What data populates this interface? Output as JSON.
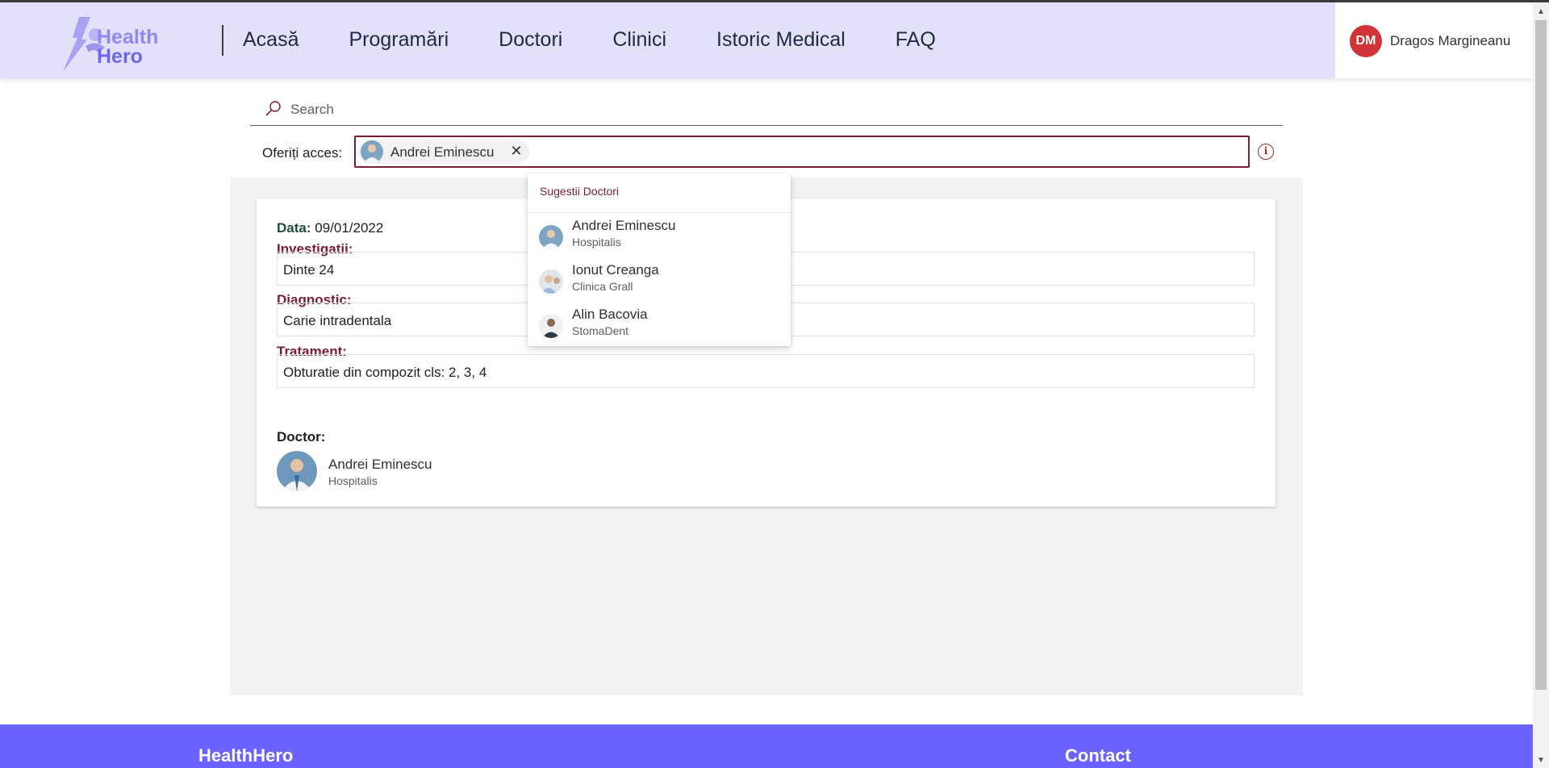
{
  "app": {
    "logo_line1": "Health",
    "logo_line2": "Hero"
  },
  "nav": {
    "items": [
      "Acasă",
      "Programări",
      "Doctori",
      "Clinici",
      "Istoric Medical",
      "FAQ"
    ]
  },
  "user": {
    "initials": "DM",
    "name": "Dragos Margineanu",
    "avatar_color": "#d13438"
  },
  "search": {
    "placeholder": "Search",
    "icon": "search-icon"
  },
  "access": {
    "label": "Oferiți acces:",
    "selected": [
      {
        "name": "Andrei Eminescu"
      }
    ]
  },
  "suggestions": {
    "header": "Sugestii Doctori",
    "items": [
      {
        "name": "Andrei Eminescu",
        "clinic": "Hospitalis"
      },
      {
        "name": "Ionut Creanga",
        "clinic": "Clinica Grall"
      },
      {
        "name": "Alin Bacovia",
        "clinic": "StomaDent"
      }
    ]
  },
  "record": {
    "date_label": "Data:",
    "date_value": "09/01/2022",
    "investigations_label": "Investigatii:",
    "investigations_value": "Dinte 24",
    "diagnostic_label": "Diagnostic:",
    "diagnostic_value": "Carie intradentala",
    "treatment_label": "Tratament:",
    "treatment_value": "Obturatie din compozit cls: 2, 3, 4",
    "doctor_label": "Doctor:",
    "doctor_name": "Andrei Eminescu",
    "doctor_clinic": "Hospitalis"
  },
  "footer": {
    "brand": "HealthHero",
    "contact": "Contact"
  },
  "colors": {
    "header_bg": "#e2e0fb",
    "accent": "#7a1c32",
    "footer_bg": "#6c63ff",
    "panel_bg": "#f3f2f1"
  }
}
